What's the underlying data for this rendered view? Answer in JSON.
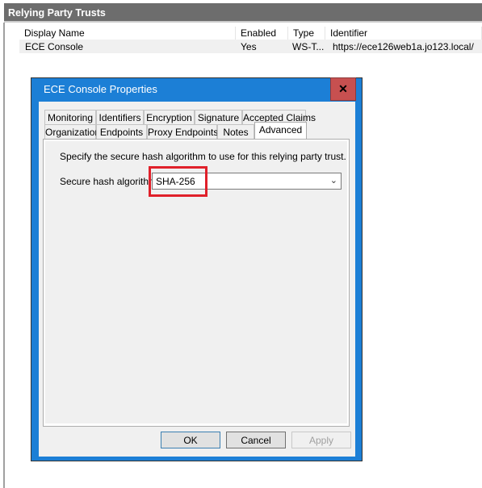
{
  "panel_title": "Relying Party Trusts",
  "list": {
    "columns": [
      "Display Name",
      "Enabled",
      "Type",
      "Identifier"
    ],
    "rows": [
      {
        "display_name": "ECE Console",
        "enabled": "Yes",
        "type": "WS-T...",
        "identifier": "https://ece126web1a.jo123.local/"
      }
    ]
  },
  "dialog": {
    "title": "ECE Console Properties",
    "close_icon": "close-icon",
    "tabs_row1": [
      "Monitoring",
      "Identifiers",
      "Encryption",
      "Signature",
      "Accepted Claims"
    ],
    "tabs_row2": [
      "Organization",
      "Endpoints",
      "Proxy Endpoints",
      "Notes",
      "Advanced"
    ],
    "selected_tab": "Advanced",
    "description": "Specify the secure hash algorithm to use for this relying party trust.",
    "hash_label": "Secure hash algorithm:",
    "hash_value": "SHA-256",
    "highlight_color": "#e0202a",
    "buttons": {
      "ok": "OK",
      "cancel": "Cancel",
      "apply": "Apply"
    }
  }
}
